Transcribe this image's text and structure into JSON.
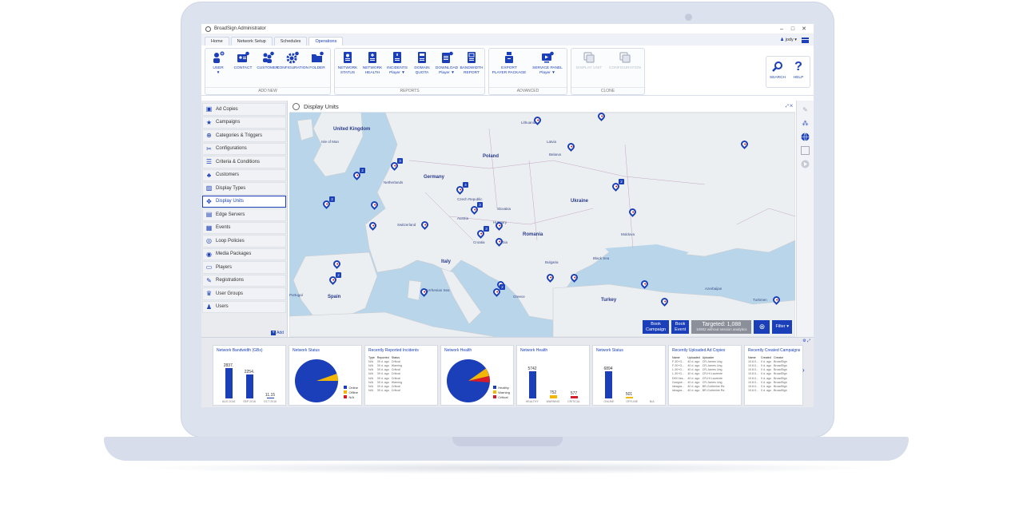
{
  "window": {
    "title": "BroadSign Administrator"
  },
  "tabs": [
    {
      "label": "Home"
    },
    {
      "label": "Network Setup"
    },
    {
      "label": "Schedules"
    },
    {
      "label": "Operations"
    }
  ],
  "user": {
    "name": "jody"
  },
  "ribbon": {
    "groups": [
      {
        "label": "ADD NEW",
        "items": [
          [
            "USER",
            "▼"
          ],
          [
            "CONTACT",
            ""
          ],
          [
            "CUSTOMER",
            ""
          ],
          [
            "CONFIGURATION",
            ""
          ],
          [
            "FOLDER",
            ""
          ]
        ]
      },
      {
        "label": "REPORTS",
        "items": [
          [
            "NETWORK",
            "STATUS"
          ],
          [
            "NETWORK",
            "HEALTH"
          ],
          [
            "INCIDENTS",
            "Player ▼"
          ],
          [
            "DOMAIN",
            "QUOTA"
          ],
          [
            "DOWNLOAD",
            "Player ▼"
          ],
          [
            "BANDWIDTH",
            "REPORT"
          ]
        ]
      },
      {
        "label": "ADVANCED",
        "items": [
          [
            "EXPORT",
            "PLAYER PACKAGE"
          ],
          [
            "SERVICE PANEL",
            "Player ▼"
          ]
        ]
      },
      {
        "label": "CLONE",
        "items": [
          [
            "DISPLAY UNIT",
            ""
          ],
          [
            "CONFIGURATION",
            ""
          ]
        ]
      }
    ],
    "search_label": "SEARCH",
    "help_label": "HELP"
  },
  "sidebar": {
    "items": [
      {
        "label": "Ad Copies",
        "icon": "ad-copy-icon"
      },
      {
        "label": "Campaigns",
        "icon": "star-icon"
      },
      {
        "label": "Categories & Triggers",
        "icon": "tag-icon"
      },
      {
        "label": "Configurations",
        "icon": "tools-icon"
      },
      {
        "label": "Criteria & Conditions",
        "icon": "list-icon"
      },
      {
        "label": "Customers",
        "icon": "users-icon"
      },
      {
        "label": "Display Types",
        "icon": "display-type-icon"
      },
      {
        "label": "Display Units",
        "icon": "display-unit-icon"
      },
      {
        "label": "Edge Servers",
        "icon": "server-icon"
      },
      {
        "label": "Events",
        "icon": "calendar-icon"
      },
      {
        "label": "Loop Policies",
        "icon": "loop-icon"
      },
      {
        "label": "Media Packages",
        "icon": "package-icon"
      },
      {
        "label": "Players",
        "icon": "player-icon"
      },
      {
        "label": "Registrations",
        "icon": "registration-icon"
      },
      {
        "label": "User Groups",
        "icon": "user-group-icon"
      },
      {
        "label": "Users",
        "icon": "user-icon"
      }
    ],
    "active": "Display Units",
    "add_label": "Add"
  },
  "panel": {
    "title": "Display Units"
  },
  "map": {
    "labels": [
      {
        "text": "United Kingdom",
        "cls": ""
      },
      {
        "text": "Isle of Man",
        "cls": "small"
      },
      {
        "text": "Lithuania",
        "cls": "small"
      },
      {
        "text": "Latvia",
        "cls": "small"
      },
      {
        "text": "Belarus",
        "cls": "small"
      },
      {
        "text": "Poland",
        "cls": ""
      },
      {
        "text": "Germany",
        "cls": ""
      },
      {
        "text": "Czech Republic",
        "cls": "small"
      },
      {
        "text": "Ukraine",
        "cls": ""
      },
      {
        "text": "Romania",
        "cls": ""
      },
      {
        "text": "Italy",
        "cls": ""
      },
      {
        "text": "Spain",
        "cls": ""
      },
      {
        "text": "Portugal",
        "cls": "small"
      },
      {
        "text": "Greece",
        "cls": "small"
      },
      {
        "text": "Turkey",
        "cls": ""
      },
      {
        "text": "Black Sea",
        "cls": "small"
      },
      {
        "text": "Tyrrhenian Sea",
        "cls": "small"
      },
      {
        "text": "Netherlands",
        "cls": "small"
      },
      {
        "text": "Austria",
        "cls": "small"
      },
      {
        "text": "Switzerland",
        "cls": "small"
      },
      {
        "text": "Hungary",
        "cls": "small"
      },
      {
        "text": "Moldova",
        "cls": "small"
      },
      {
        "text": "Bulgaria",
        "cls": "small"
      },
      {
        "text": "Serbia",
        "cls": "small"
      },
      {
        "text": "Croatia",
        "cls": "small"
      },
      {
        "text": "Slovakia",
        "cls": "small"
      },
      {
        "text": "Azerbaijan",
        "cls": "small"
      },
      {
        "text": "Turkmen",
        "cls": "small"
      }
    ],
    "badges": [
      "2",
      "3",
      "4",
      "2",
      "2",
      "3",
      "3",
      "2",
      "2"
    ],
    "book_campaign": [
      "Book",
      "Campaign"
    ],
    "book_event": [
      "Book",
      "Event"
    ],
    "targeted": "Targeted: 1,088",
    "targeted_sub": "10902 without session analytics",
    "filter_label": "Filter"
  },
  "widgets": {
    "bandwidth": {
      "title": "Network Bandwidth (GBs)",
      "values": [
        "2837.",
        "2254.",
        "11.15"
      ],
      "cats": [
        "AUG 2016",
        "SEP 2016",
        "OCT 2016"
      ]
    },
    "net_status_pie": {
      "title": "Network Status",
      "legend": [
        "Online",
        "Offline",
        "N/A"
      ]
    },
    "incidents": {
      "title": "Recently Reported Incidents",
      "headers": [
        "Type",
        "Reported",
        "Status"
      ],
      "rows": [
        [
          "N/A",
          "39 d. ago",
          "Critical"
        ],
        [
          "N/A",
          "39 d. ago",
          "Warning"
        ],
        [
          "N/A",
          "39 d. ago",
          "Critical"
        ],
        [
          "N/A",
          "39 d. ago",
          "Critical"
        ],
        [
          "N/A",
          "39 d. ago",
          "Critical"
        ],
        [
          "N/A",
          "39 d. ago",
          "Warning"
        ],
        [
          "N/A",
          "39 d. ago",
          "Critical"
        ],
        [
          "N/A",
          "39 d. ago",
          "Critical"
        ]
      ]
    },
    "health_pie": {
      "title": "Network Health",
      "legend": [
        "Healthy",
        "Warning",
        "Critical"
      ]
    },
    "health_bars": {
      "title": "Network Health",
      "values": [
        "5742",
        "752",
        "577"
      ],
      "cats": [
        "HEALTHY",
        "WARNING",
        "CRITICAL"
      ]
    },
    "status_bars": {
      "title": "Network Status",
      "values": [
        "6894",
        "501",
        ""
      ],
      "cats": [
        "ONLINE",
        "OFFLINE",
        "N/A"
      ]
    },
    "ad_copies": {
      "title": "Recently Uploaded Ad Copies",
      "headers": [
        "Name",
        "Uploaded",
        "Uploader"
      ],
      "rows": [
        [
          "F-30+G...",
          "40 d. ago",
          "CR-James Ling"
        ],
        [
          "F-30+G...",
          "40 d. ago",
          "CR-James Ling"
        ],
        [
          "L-30+G...",
          "40 d. ago",
          "CR-James Ling"
        ],
        [
          "L-30+G...",
          "40 d. ago",
          "CR-HI Laurente"
        ],
        [
          "DKH tes...",
          "40 d. ago",
          "CR-HI Laurente"
        ],
        [
          "Gangne...",
          "40 d. ago",
          "CR-James Ling"
        ],
        [
          "ideagra...",
          "40 d. ago",
          "BR-Gutherine Ra"
        ],
        [
          "ideagra...",
          "40 d. ago",
          "BR-Gutherine Ra"
        ]
      ]
    },
    "campaigns": {
      "title": "Recently Created Campaigns",
      "headers": [
        "Name",
        "Created",
        "Creator"
      ],
      "rows": [
        [
          "10.8.0...",
          "0 d. ago",
          "BroadSign"
        ],
        [
          "10.8.0...",
          "0 d. ago",
          "BroadSign"
        ],
        [
          "10.8.0...",
          "0 d. ago",
          "BroadSign"
        ],
        [
          "10.8.0...",
          "0 d. ago",
          "BroadSign"
        ],
        [
          "10.8.0...",
          "0 d. ago",
          "BroadSign"
        ],
        [
          "10.8.0...",
          "0 d. ago",
          "BroadSign"
        ],
        [
          "10.8.0...",
          "0 d. ago",
          "BroadSign"
        ],
        [
          "10.8.0...",
          "0 d. ago",
          "BroadSign"
        ]
      ]
    }
  },
  "colors": {
    "accent": "#1a3fb8",
    "yellow": "#f2b705",
    "red": "#d81b28",
    "water": "#b9d5ea",
    "land": "#eceff1"
  }
}
